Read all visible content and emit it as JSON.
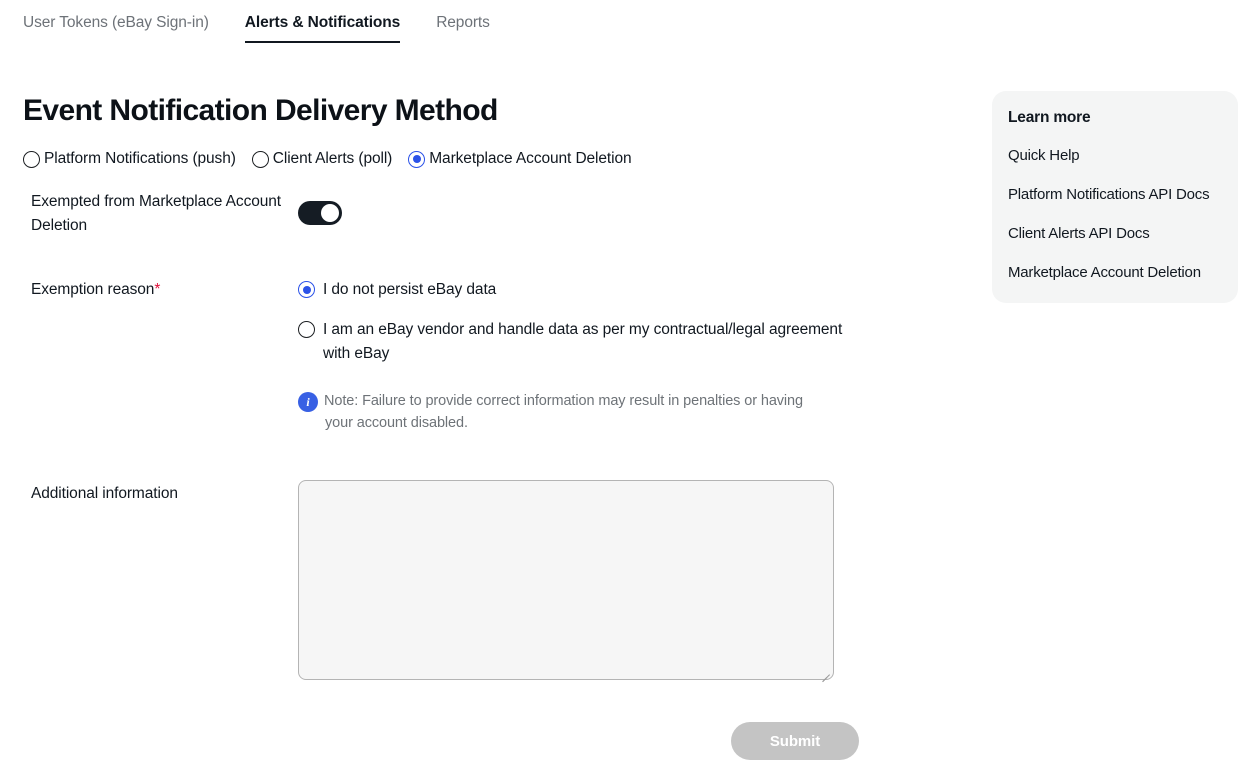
{
  "tabs": [
    {
      "label": "User Tokens (eBay Sign-in)",
      "active": false
    },
    {
      "label": "Alerts & Notifications",
      "active": true
    },
    {
      "label": "Reports",
      "active": false
    }
  ],
  "page": {
    "title": "Event Notification Delivery Method"
  },
  "delivery_method": {
    "options": [
      {
        "label": "Platform Notifications (push)",
        "selected": false
      },
      {
        "label": "Client Alerts (poll)",
        "selected": false
      },
      {
        "label": "Marketplace Account Deletion",
        "selected": true
      }
    ]
  },
  "exempted": {
    "label": "Exempted from Marketplace Account Deletion",
    "toggle_state": "on"
  },
  "exemption_reason": {
    "label": "Exemption reason",
    "required_marker": "*",
    "options": [
      {
        "label": "I do not persist eBay data",
        "selected": true
      },
      {
        "label": "I am an eBay vendor and handle data as per my contractual/legal agreement with eBay",
        "selected": false
      }
    ],
    "note_icon": "info-icon",
    "note": "Note: Failure to provide correct information may result in penalties or having your account disabled."
  },
  "additional_information": {
    "label": "Additional information",
    "value": "",
    "placeholder": ""
  },
  "submit": {
    "label": "Submit",
    "disabled": true
  },
  "learn_more": {
    "title": "Learn more",
    "links": [
      {
        "label": "Quick Help"
      },
      {
        "label": "Platform Notifications API Docs"
      },
      {
        "label": "Client Alerts API Docs"
      },
      {
        "label": "Marketplace Account Deletion"
      }
    ]
  },
  "colors": {
    "accent_blue": "#2b52e8",
    "info_blue": "#3860e4",
    "required_red": "#e0103a",
    "toggle_on": "#151c24",
    "panel_bg": "#f4f5f5",
    "disabled_button": "#c4c4c4",
    "text_primary": "#111820",
    "text_muted": "#6e7378"
  }
}
